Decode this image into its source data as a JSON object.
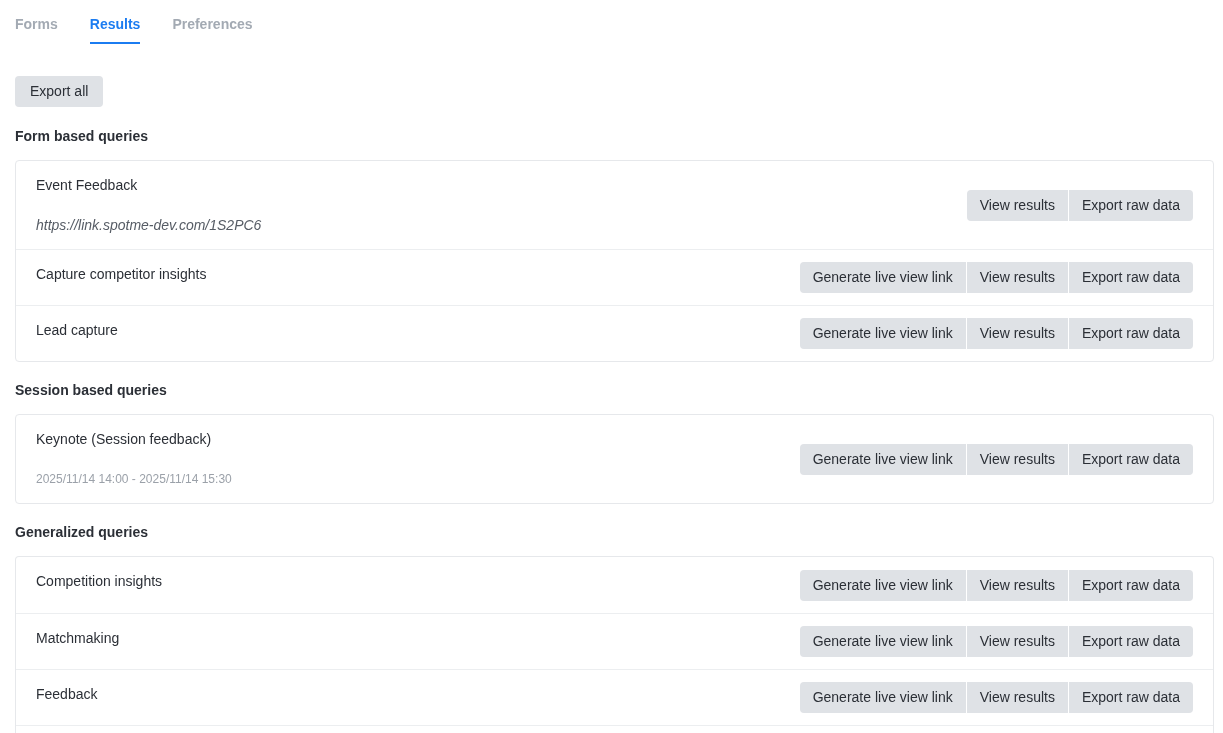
{
  "tabs": [
    {
      "label": "Forms",
      "selected": false
    },
    {
      "label": "Results",
      "selected": true
    },
    {
      "label": "Preferences",
      "selected": false
    }
  ],
  "export_all_button": "Export all",
  "sections": [
    {
      "heading": "Form based queries",
      "continues_below": false,
      "queries": [
        {
          "title": "Event Feedback",
          "url": "https://link.spotme-dev.com/1S2PC6",
          "actions": [
            "View results",
            "Export raw data"
          ]
        },
        {
          "title": "Capture competitor insights",
          "actions": [
            "Generate live view link",
            "View results",
            "Export raw data"
          ]
        },
        {
          "title": "Lead capture",
          "actions": [
            "Generate live view link",
            "View results",
            "Export raw data"
          ]
        }
      ]
    },
    {
      "heading": "Session based queries",
      "continues_below": false,
      "queries": [
        {
          "title": "Keynote (Session feedback)",
          "time": "2025/11/14 14:00 - 2025/11/14 15:30",
          "actions": [
            "Generate live view link",
            "View results",
            "Export raw data"
          ]
        }
      ]
    },
    {
      "heading": "Generalized queries",
      "continues_below": true,
      "queries": [
        {
          "title": "Competition insights",
          "actions": [
            "Generate live view link",
            "View results",
            "Export raw data"
          ]
        },
        {
          "title": "Matchmaking",
          "actions": [
            "Generate live view link",
            "View results",
            "Export raw data"
          ]
        },
        {
          "title": "Feedback",
          "actions": [
            "Generate live view link",
            "View results",
            "Export raw data"
          ]
        }
      ]
    }
  ]
}
